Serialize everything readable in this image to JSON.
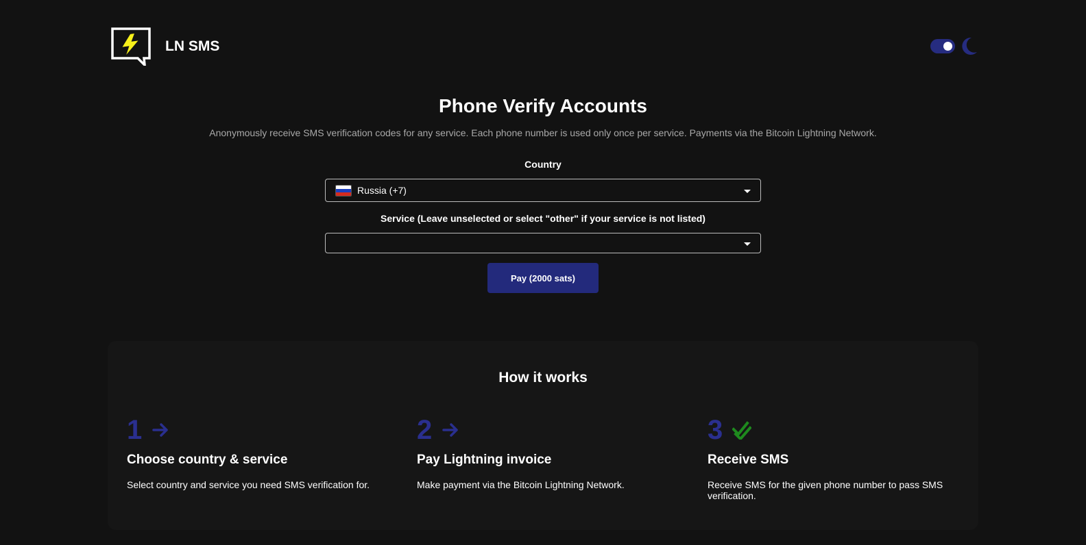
{
  "header": {
    "brand": "LN SMS",
    "logo_icon": "lightning-chat-icon",
    "theme_toggle": {
      "state": "dark",
      "icon": "moon-icon"
    }
  },
  "hero": {
    "title": "Phone Verify Accounts",
    "subtitle": "Anonymously receive SMS verification codes for any service. Each phone number is used only once per service. Payments via the Bitcoin Lightning Network."
  },
  "form": {
    "country_label": "Country",
    "country_value": "Russia (+7)",
    "country_flag": "russia-flag-icon",
    "service_label": "Service (Leave unselected or select \"other\" if your service is not listed)",
    "service_value": "",
    "pay_label": "Pay (2000 sats)"
  },
  "how": {
    "title": "How it works",
    "steps": [
      {
        "num": "1",
        "icon": "arrow-right-icon",
        "title": "Choose country & service",
        "desc": "Select country and service you need SMS verification for."
      },
      {
        "num": "2",
        "icon": "arrow-right-icon",
        "title": "Pay Lightning invoice",
        "desc": "Make payment via the Bitcoin Lightning Network."
      },
      {
        "num": "3",
        "icon": "double-check-icon",
        "title": "Receive SMS",
        "desc": "Receive SMS for the given phone number to pass SMS verification."
      }
    ]
  },
  "colors": {
    "background": "#121212",
    "card": "#161616",
    "accent": "#232a7c",
    "step_number": "#2a2f8f",
    "check": "#1e8a1e",
    "lightning": "#f7f01a"
  }
}
